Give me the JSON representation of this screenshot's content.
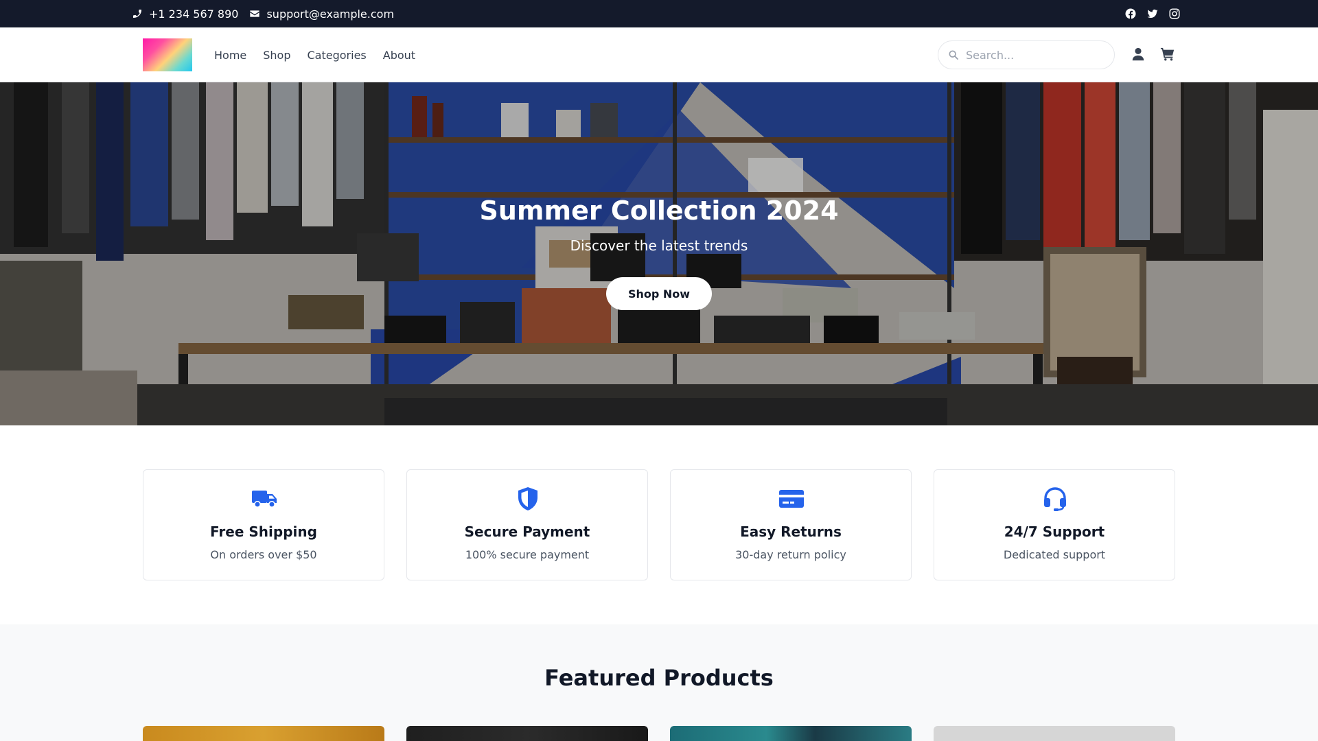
{
  "topbar": {
    "phone": "+1 234 567 890",
    "email": "support@example.com",
    "social": [
      "facebook-icon",
      "twitter-icon",
      "instagram-icon"
    ]
  },
  "header": {
    "nav": [
      "Home",
      "Shop",
      "Categories",
      "About"
    ],
    "search_placeholder": "Search...",
    "icons": [
      "user-icon",
      "cart-icon"
    ]
  },
  "hero": {
    "title": "Summer Collection 2024",
    "subtitle": "Discover the latest trends",
    "button": "Shop Now"
  },
  "features": [
    {
      "icon": "truck-icon",
      "title": "Free Shipping",
      "desc": "On orders over $50"
    },
    {
      "icon": "shield-icon",
      "title": "Secure Payment",
      "desc": "100% secure payment"
    },
    {
      "icon": "credit-card-icon",
      "title": "Easy Returns",
      "desc": "30-day return policy"
    },
    {
      "icon": "headset-icon",
      "title": "24/7 Support",
      "desc": "Dedicated support"
    }
  ],
  "featured": {
    "title": "Featured Products"
  },
  "colors": {
    "topbar_bg": "#141a2b",
    "accent_blue": "#2563eb",
    "section_bg": "#f8f9fa"
  }
}
